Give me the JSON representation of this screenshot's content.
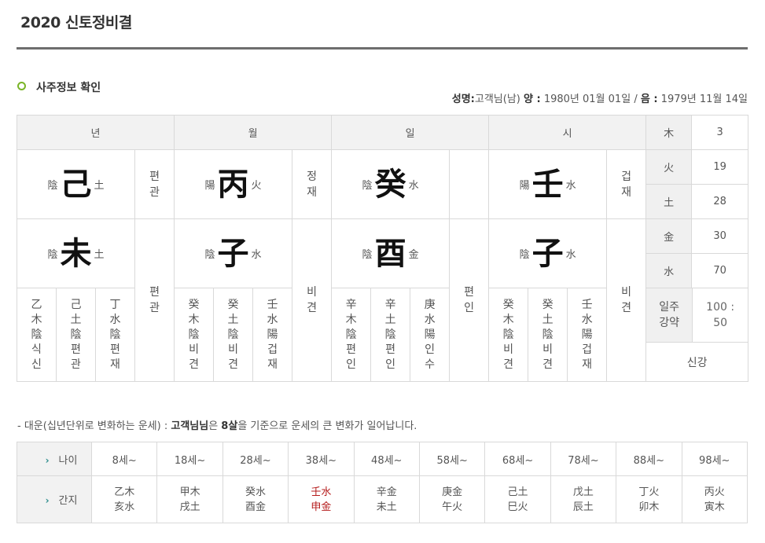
{
  "header": {
    "title": "2020 신토정비결"
  },
  "section": {
    "title": "사주정보 확인"
  },
  "info": {
    "name_label": "성명:",
    "name_value": "고객님(남)",
    "solar_label": "양 :",
    "solar_value": "1980년 01월 01일",
    "sep": "/",
    "lunar_label": "음 :",
    "lunar_value": "1979년 11월 14일"
  },
  "saju": {
    "headers": [
      "년",
      "월",
      "일",
      "시"
    ],
    "stems": [
      {
        "yy": "陰",
        "char": "己",
        "el": "土",
        "sipsin": "편관"
      },
      {
        "yy": "陽",
        "char": "丙",
        "el": "火",
        "sipsin": "정재"
      },
      {
        "yy": "陰",
        "char": "癸",
        "el": "水",
        "sipsin": ""
      },
      {
        "yy": "陽",
        "char": "壬",
        "el": "水",
        "sipsin": "겁재"
      }
    ],
    "branches": [
      {
        "yy": "陰",
        "char": "未",
        "el": "土",
        "sipsin": "편관"
      },
      {
        "yy": "陰",
        "char": "子",
        "el": "水",
        "sipsin": "비견"
      },
      {
        "yy": "陰",
        "char": "酉",
        "el": "金",
        "sipsin": "편인"
      },
      {
        "yy": "陰",
        "char": "子",
        "el": "水",
        "sipsin": "비견"
      }
    ],
    "jijanggan": [
      [
        "乙木陰식신",
        "己土陰편관",
        "丁水陰편재"
      ],
      [
        "癸木陰비견",
        "癸土陰비견",
        "壬水陽겁재"
      ],
      [
        "辛木陰편인",
        "辛土陰편인",
        "庚水陽인수"
      ],
      [
        "癸木陰비견",
        "癸土陰비견",
        "壬水陽겁재"
      ]
    ],
    "elements": [
      {
        "label": "木",
        "value": "3"
      },
      {
        "label": "火",
        "value": "19"
      },
      {
        "label": "土",
        "value": "28"
      },
      {
        "label": "金",
        "value": "30"
      },
      {
        "label": "水",
        "value": "70"
      }
    ],
    "strength_label": "일주강약",
    "strength_value": "100 : 50",
    "strength_result": "신강"
  },
  "note": {
    "prefix": "- 대운(십년단위로 변화하는 운세) : ",
    "name": "고객님님",
    "mid": "은 ",
    "age": "8살",
    "suffix": "을 기준으로 운세의 큰 변화가 일어납니다."
  },
  "daeun": {
    "age_label": "나이",
    "ganji_label": "간지",
    "arrow": "›",
    "ages": [
      "8세~",
      "18세~",
      "28세~",
      "38세~",
      "48세~",
      "58세~",
      "68세~",
      "78세~",
      "88세~",
      "98세~"
    ],
    "top": [
      "乙木",
      "甲木",
      "癸水",
      "壬水",
      "辛金",
      "庚金",
      "己土",
      "戊土",
      "丁火",
      "丙火"
    ],
    "bottom": [
      "亥水",
      "戌土",
      "酉金",
      "申金",
      "未土",
      "午火",
      "巳火",
      "辰土",
      "卯木",
      "寅木"
    ],
    "highlight_color": "#b51c1c"
  }
}
